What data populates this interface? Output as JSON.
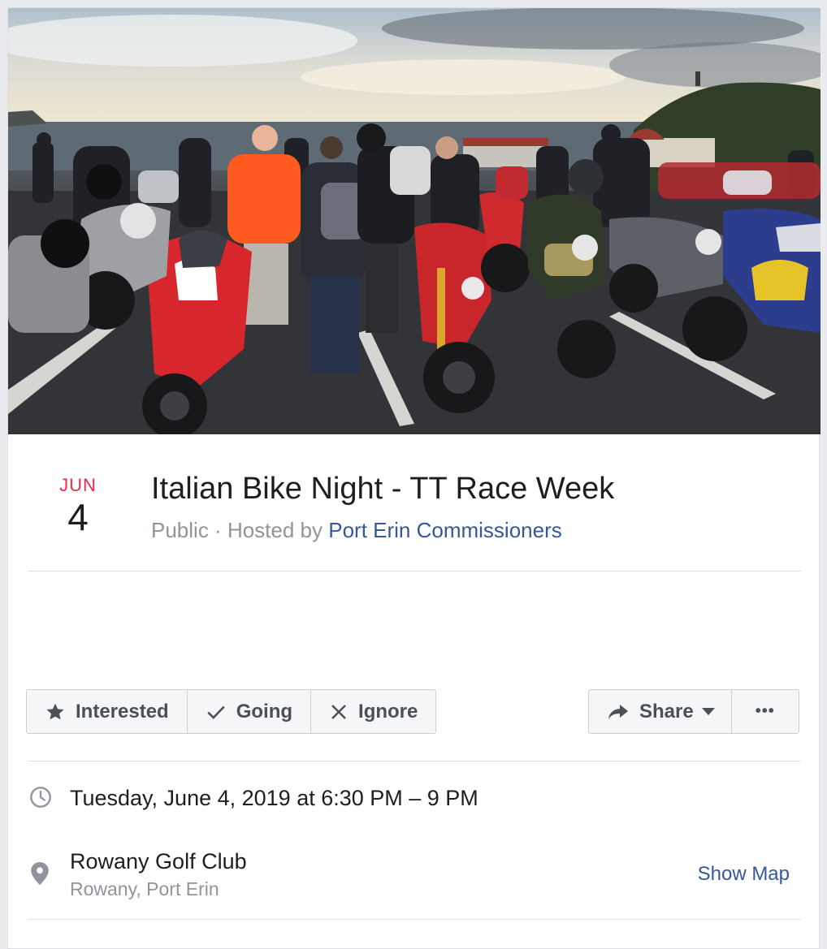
{
  "event": {
    "month": "JUN",
    "day": "4",
    "title": "Italian Bike Night - TT Race Week",
    "privacy": "Public",
    "separator": " · ",
    "hosted_by_prefix": "Hosted by ",
    "host": "Port Erin Commissioners"
  },
  "actions": {
    "interested": "Interested",
    "going": "Going",
    "ignore": "Ignore",
    "share": "Share",
    "more": "•••"
  },
  "details": {
    "datetime": "Tuesday, June 4, 2019 at 6:30 PM – 9 PM",
    "location_name": "Rowany Golf Club",
    "location_address": "Rowany, Port Erin",
    "show_map": "Show Map"
  },
  "icons": {
    "interested": "star-icon",
    "going": "checkmark-icon",
    "ignore": "x-icon",
    "share": "share-arrow-icon",
    "share_dropdown": "caret-down-icon",
    "more": "ellipsis-icon",
    "time": "clock-icon",
    "location": "map-pin-icon"
  },
  "colors": {
    "month_red": "#f02849",
    "link_blue": "#365899",
    "text_primary": "#1c1e21",
    "text_secondary": "#90949c",
    "button_bg": "#f5f6f7",
    "button_text": "#4b4f56"
  }
}
